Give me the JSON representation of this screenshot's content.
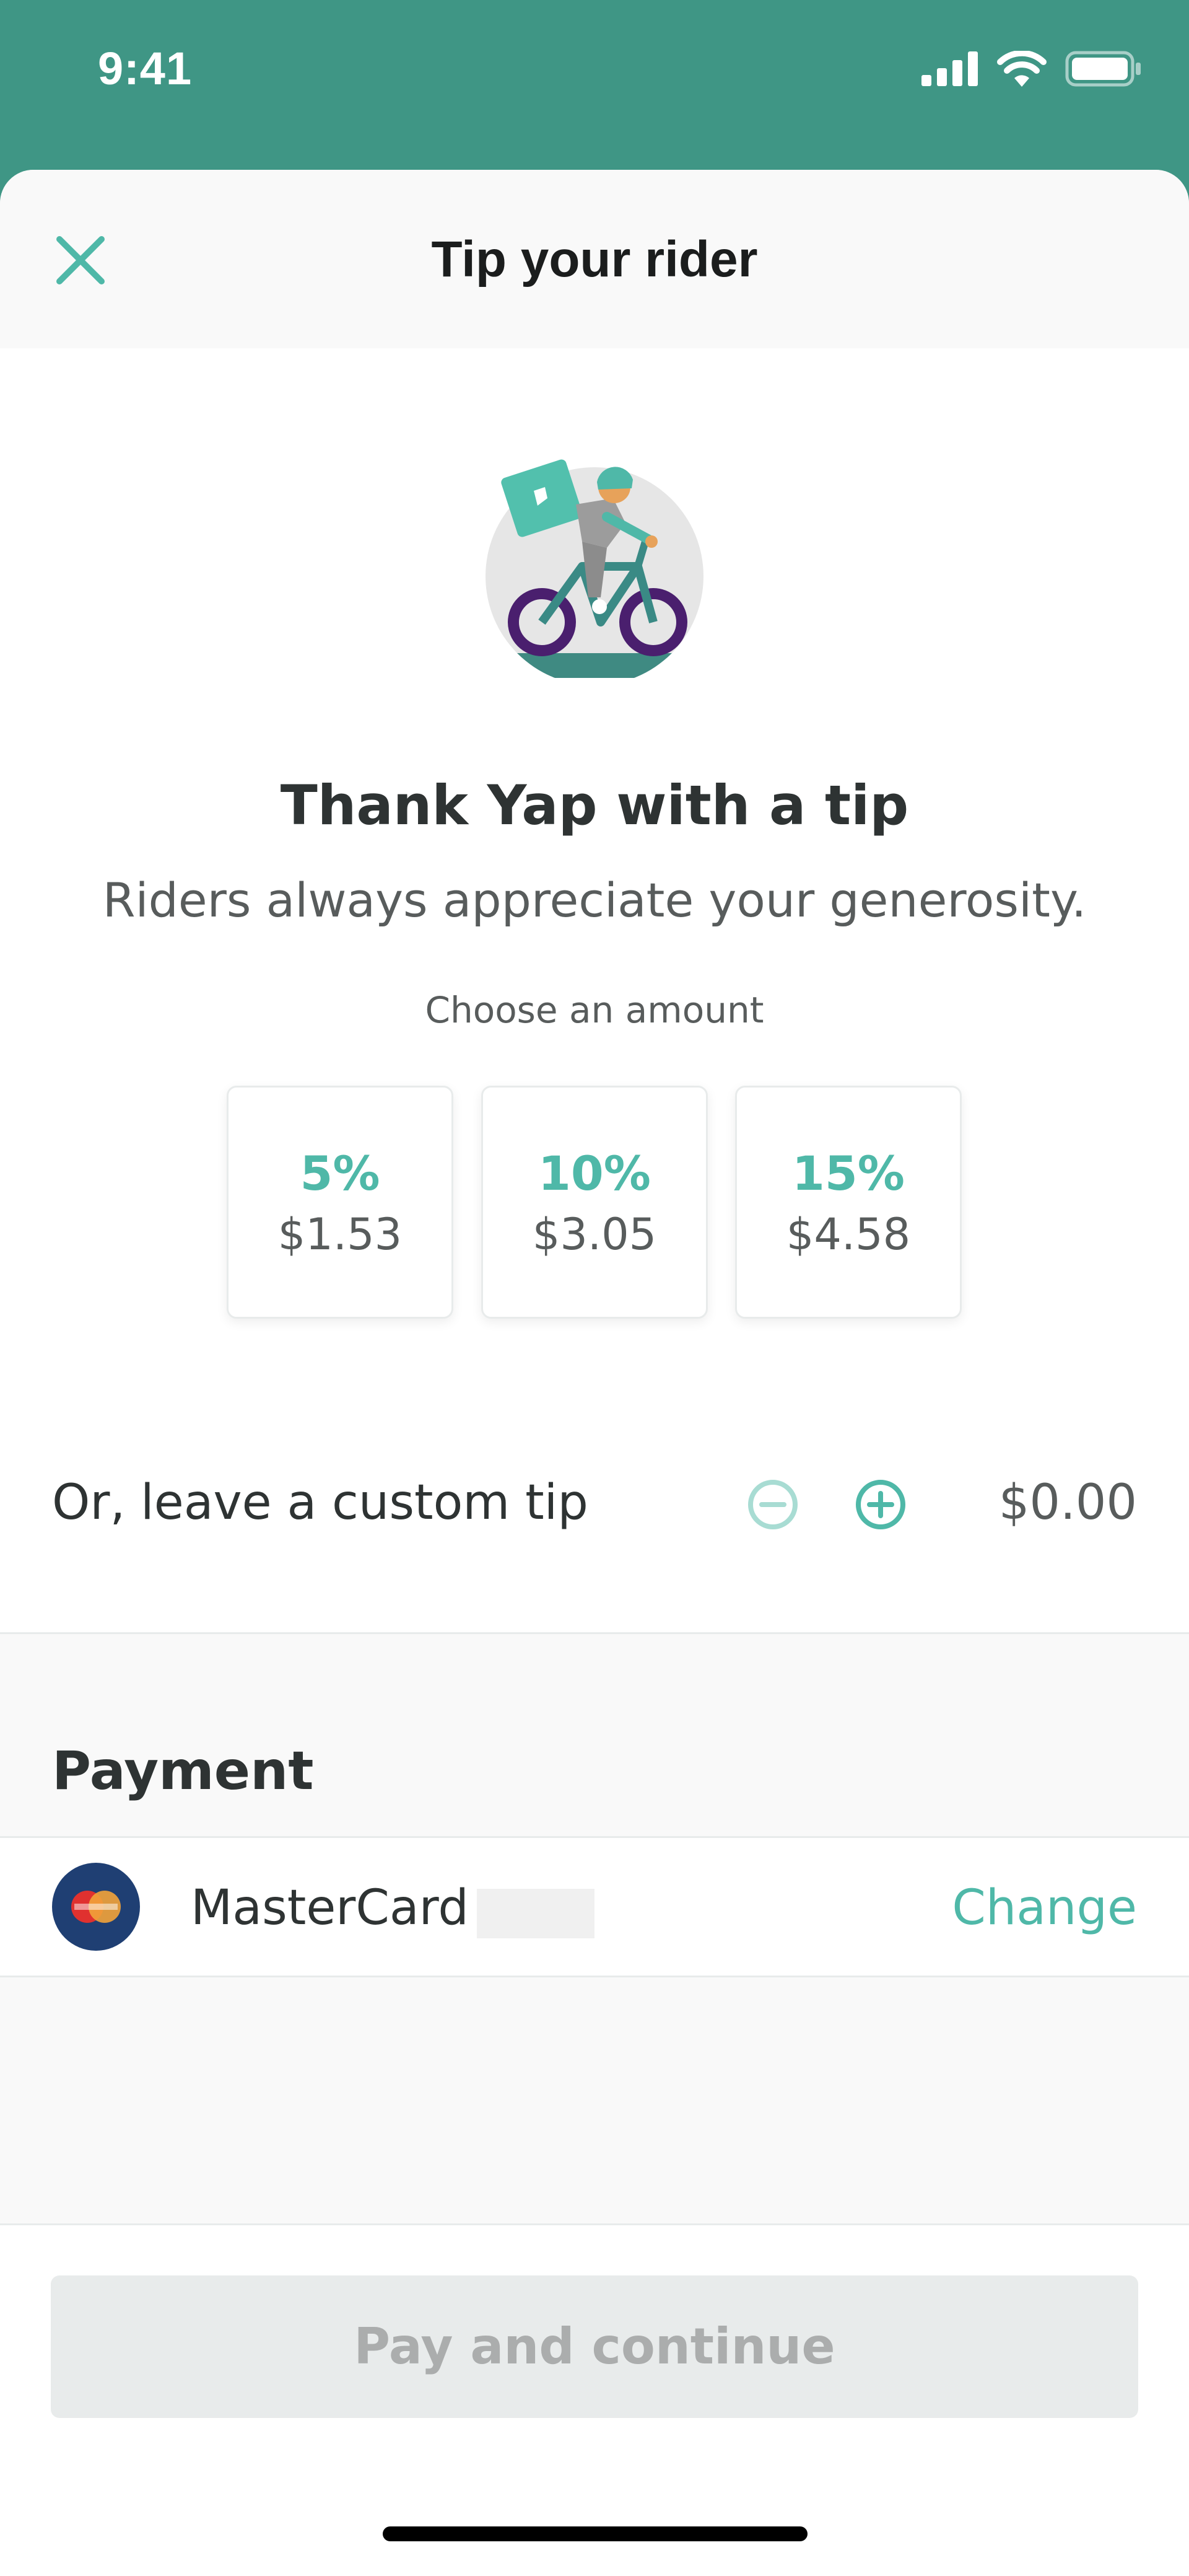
{
  "status_bar": {
    "time": "9:41",
    "icons": [
      "signal-icon",
      "wifi-icon",
      "battery-icon"
    ]
  },
  "header": {
    "title": "Tip your rider",
    "close_icon": "close-icon"
  },
  "hero": {
    "illustration": "rider-on-bicycle-illustration",
    "heading": "Thank Yap with a tip",
    "subheading": "Riders always appreciate your generosity.",
    "choose_label": "Choose an amount"
  },
  "amounts": [
    {
      "percent": "5%",
      "value": "$1.53"
    },
    {
      "percent": "10%",
      "value": "$3.05"
    },
    {
      "percent": "15%",
      "value": "$4.58"
    }
  ],
  "custom_tip": {
    "label": "Or, leave a custom tip",
    "value": "$0.00",
    "decrement_icon": "minus-circle-icon",
    "increment_icon": "plus-circle-icon",
    "decrement_enabled": false,
    "increment_enabled": true
  },
  "payment": {
    "title": "Payment",
    "card_name": "MasterCard",
    "card_icon": "mastercard-icon",
    "change_label": "Change"
  },
  "footer": {
    "pay_button_label": "Pay and continue",
    "pay_button_enabled": false
  },
  "colors": {
    "brand": "#3f9685",
    "accent": "#4fb8a8",
    "text_primary": "#2e3333",
    "text_secondary": "#585c5c",
    "disabled_bg": "#e8ebeb",
    "disabled_text": "#abadad"
  }
}
